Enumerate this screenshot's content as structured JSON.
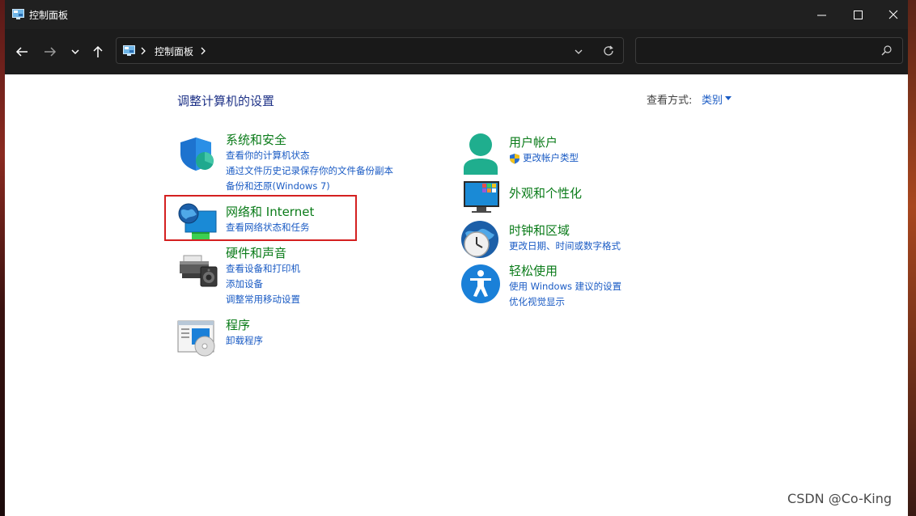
{
  "window": {
    "title": "控制面板"
  },
  "address": {
    "crumb": "控制面板"
  },
  "search": {
    "placeholder": ""
  },
  "page": {
    "title": "调整计算机的设置",
    "view_label": "查看方式:",
    "view_value": "类别"
  },
  "categories": {
    "system": {
      "title": "系统和安全",
      "links": [
        "查看你的计算机状态",
        "通过文件历史记录保存你的文件备份副本",
        "备份和还原(Windows 7)"
      ]
    },
    "network": {
      "title": "网络和 Internet",
      "links": [
        "查看网络状态和任务"
      ]
    },
    "hardware": {
      "title": "硬件和声音",
      "links": [
        "查看设备和打印机",
        "添加设备",
        "调整常用移动设置"
      ]
    },
    "programs": {
      "title": "程序",
      "links": [
        "卸载程序"
      ]
    },
    "users": {
      "title": "用户帐户",
      "links": [
        "更改帐户类型"
      ]
    },
    "appearance": {
      "title": "外观和个性化",
      "links": []
    },
    "clock": {
      "title": "时钟和区域",
      "links": [
        "更改日期、时间或数字格式"
      ]
    },
    "ease": {
      "title": "轻松使用",
      "links": [
        "使用 Windows 建议的设置",
        "优化视觉显示"
      ]
    }
  },
  "watermark": "CSDN @Co-King",
  "colors": {
    "category_title": "#0a7b19",
    "link": "#1a5bc4",
    "page_title": "#1e3287",
    "titlebar": "#202020",
    "highlight": "#d42020"
  }
}
